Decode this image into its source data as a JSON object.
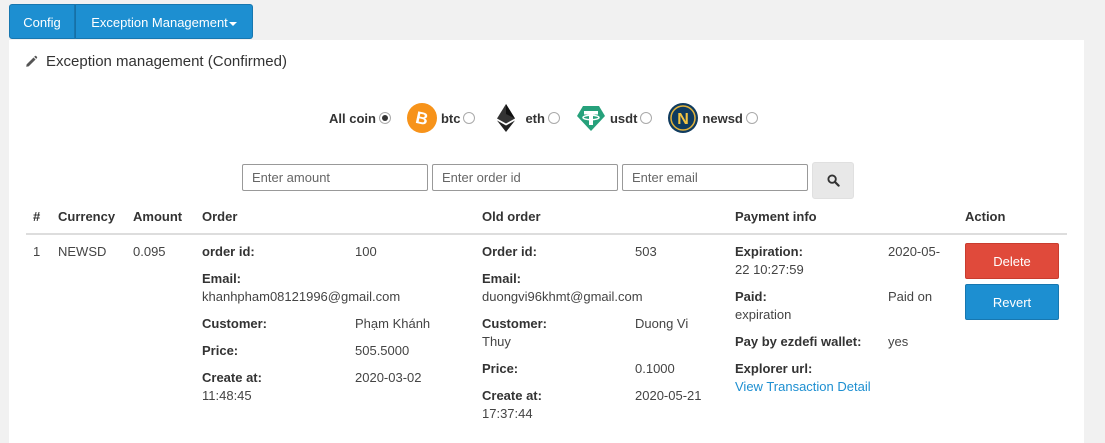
{
  "nav": {
    "config_label": "Config",
    "exception_label": "Exception Management"
  },
  "panel": {
    "title": "Exception management (Confirmed)"
  },
  "coins": [
    {
      "label": "All coin",
      "checked": true
    },
    {
      "label": "btc",
      "icon": "bitcoin-icon",
      "color": "#f7931a"
    },
    {
      "label": "eth",
      "icon": "ethereum-icon",
      "color": "#222222"
    },
    {
      "label": "usdt",
      "icon": "tether-icon",
      "color": "#26a17b"
    },
    {
      "label": "newsd",
      "icon": "newsd-icon",
      "color": "#0f3b5f"
    }
  ],
  "search": {
    "amount_placeholder": "Enter amount",
    "order_placeholder": "Enter order id",
    "email_placeholder": "Enter email"
  },
  "table": {
    "headers": [
      "#",
      "Currency",
      "Amount",
      "Order",
      "Old order",
      "Payment info",
      "Action"
    ],
    "rows": [
      {
        "index": "1",
        "currency": "NEWSD",
        "amount": "0.095",
        "order": {
          "order_id_label": "order id:",
          "order_id": "100",
          "email_label": "Email:",
          "email": "khanhpham08121996@gmail.com",
          "customer_label": "Customer:",
          "customer": "Phạm Khánh",
          "price_label": "Price:",
          "price": "505.5000",
          "create_label": "Create at:",
          "create_date": "2020-03-02",
          "create_time": "11:48:45"
        },
        "old_order": {
          "order_id_label": "Order id:",
          "order_id": "503",
          "email_label": "Email:",
          "email": "duongvi96khmt@gmail.com",
          "customer_label": "Customer:",
          "customer_first": "Duong Vi",
          "customer_second": "Thuy",
          "price_label": "Price:",
          "price": "0.1000",
          "create_label": "Create at:",
          "create_date": "2020-05-21",
          "create_time": "17:37:44"
        },
        "payment": {
          "expiration_label": "Expiration:",
          "expiration_date": "2020-05-",
          "expiration_rest": "22 10:27:59",
          "paid_label": "Paid:",
          "paid_value": "Paid on",
          "paid_rest": "expiration",
          "ezdefi_label": "Pay by ezdefi wallet:",
          "ezdefi_value": "yes",
          "explorer_label": "Explorer url:",
          "explorer_link": "View Transaction Detail"
        },
        "actions": {
          "delete": "Delete",
          "revert": "Revert"
        }
      }
    ]
  }
}
